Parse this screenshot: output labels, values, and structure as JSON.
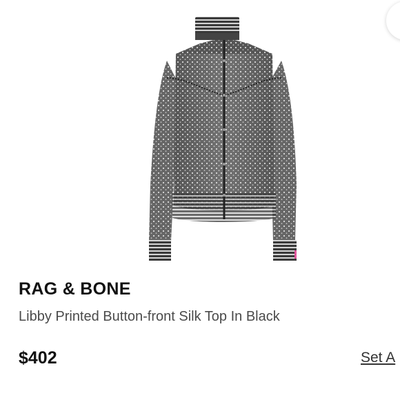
{
  "product": {
    "brand": "RAG & BONE",
    "name": "Libby Printed Button-front Silk Top In Black",
    "price": "$402",
    "alert_link": "Set A"
  },
  "icons": {
    "favorite_button": "favorite-button"
  },
  "colors": {
    "text_primary": "#111111",
    "text_secondary": "#4a4a4a",
    "background": "#ffffff"
  }
}
